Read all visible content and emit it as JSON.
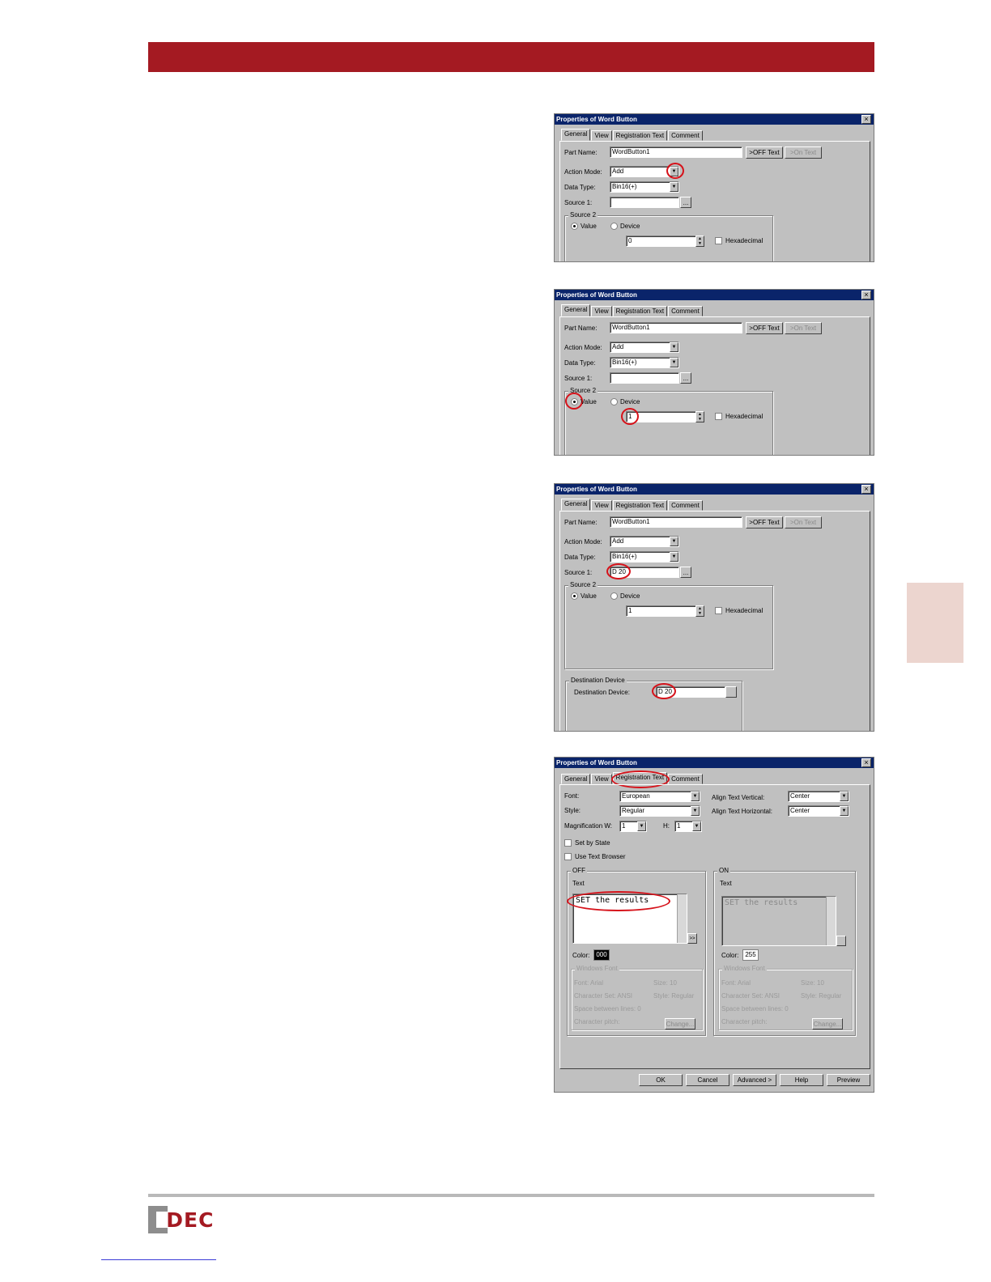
{
  "brand": {
    "logo_text": "IDEC"
  },
  "dialogs": [
    {
      "title": "Properties of Word Button",
      "tabs": [
        "General",
        "View",
        "Registration Text",
        "Comment"
      ],
      "active_tab": "General",
      "part_name_label": "Part Name:",
      "part_name_value": "WordButton1",
      "off_text_button": ">OFF Text",
      "on_text_button": ">On Text",
      "action_mode_label": "Action Mode:",
      "action_mode_value": "Add",
      "data_type_label": "Data Type:",
      "data_type_value": "Bin16(+)",
      "source1_label": "Source 1:",
      "source1_value": "",
      "browse_label": "...",
      "source2_label": "Source 2",
      "value_radio_label": "Value",
      "device_radio_label": "Device",
      "source2_value": "0",
      "hexadecimal_label": "Hexadecimal"
    },
    {
      "title": "Properties of Word Button",
      "tabs": [
        "General",
        "View",
        "Registration Text",
        "Comment"
      ],
      "active_tab": "General",
      "part_name_label": "Part Name:",
      "part_name_value": "WordButton1",
      "off_text_button": ">OFF Text",
      "on_text_button": ">On Text",
      "action_mode_label": "Action Mode:",
      "action_mode_value": "Add",
      "data_type_label": "Data Type:",
      "data_type_value": "Bin16(+)",
      "source1_label": "Source 1:",
      "source1_value": "",
      "browse_label": "...",
      "source2_label": "Source 2",
      "value_radio_label": "Value",
      "device_radio_label": "Device",
      "source2_value": "1",
      "hexadecimal_label": "Hexadecimal"
    },
    {
      "title": "Properties of Word Button",
      "tabs": [
        "General",
        "View",
        "Registration Text",
        "Comment"
      ],
      "active_tab": "General",
      "part_name_label": "Part Name:",
      "part_name_value": "WordButton1",
      "off_text_button": ">OFF Text",
      "on_text_button": ">On Text",
      "action_mode_label": "Action Mode:",
      "action_mode_value": "Add",
      "data_type_label": "Data Type:",
      "data_type_value": "Bin16(+)",
      "source1_label": "Source 1:",
      "source1_value": "D 20",
      "browse_label": "...",
      "source2_label": "Source 2",
      "value_radio_label": "Value",
      "device_radio_label": "Device",
      "source2_value": "1",
      "hexadecimal_label": "Hexadecimal",
      "dest_group_label": "Destination Device",
      "dest_label": "Destination Device:",
      "dest_value": "D 20"
    },
    {
      "title": "Properties of Word Button",
      "tabs": [
        "General",
        "View",
        "Registration Text",
        "Comment"
      ],
      "active_tab": "Registration Text",
      "font_label": "Font:",
      "font_value": "European",
      "style_label": "Style:",
      "style_value": "Regular",
      "magnification_label": "Magnification  W:",
      "mag_w_value": "1",
      "mag_h_label": "H:",
      "mag_h_value": "1",
      "align_vertical_label": "Align Text Vertical:",
      "align_vertical_value": "Center",
      "align_horizontal_label": "Align Text Horizontal:",
      "align_horizontal_value": "Center",
      "set_by_state_label": "Set by State",
      "use_text_browser_label": "Use Text Browser",
      "off_group_label": "OFF",
      "on_group_label": "ON",
      "text_label": "Text",
      "off_text_value": "SET the results",
      "on_text_value": "SET the results",
      "expand_label": ">>",
      "color_label": "Color:",
      "off_color_value": "000",
      "on_color_value": "255",
      "windows_font_label": "Windows Font",
      "font_arial": "Font: Arial",
      "size_10": "Size: 10",
      "charset": "Character Set: ANSI",
      "style_regular": "Style: Regular",
      "space_between": "Space between lines: 0",
      "char_pitch": "Character pitch:",
      "change_label": "Change...",
      "ok": "OK",
      "cancel": "Cancel",
      "advanced": "Advanced >",
      "help": "Help",
      "preview": "Preview"
    }
  ]
}
